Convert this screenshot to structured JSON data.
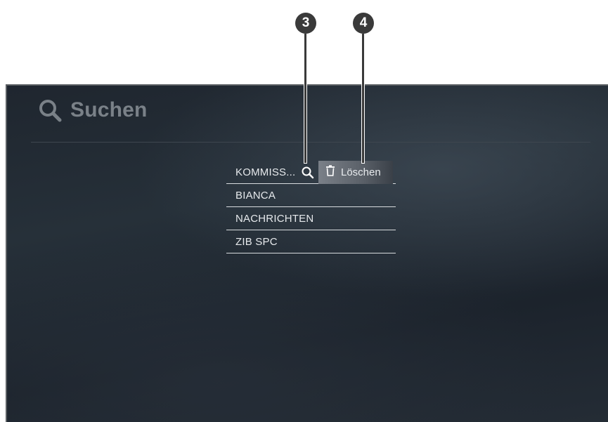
{
  "header": {
    "title": "Suchen",
    "icon": "search-icon"
  },
  "history": {
    "items": [
      {
        "label": "KOMMISS..."
      },
      {
        "label": "BIANCA"
      },
      {
        "label": "NACHRICHTEN"
      },
      {
        "label": "ZIB SPC"
      }
    ],
    "delete_label": "Löschen",
    "row_search_icon": "search-icon",
    "delete_icon": "trash-icon"
  },
  "callouts": [
    {
      "number": "3"
    },
    {
      "number": "4"
    }
  ],
  "colors": {
    "background": "#222a33",
    "text": "#e6e9ec",
    "title": "#7a8188",
    "callout": "#3a3a3a"
  }
}
